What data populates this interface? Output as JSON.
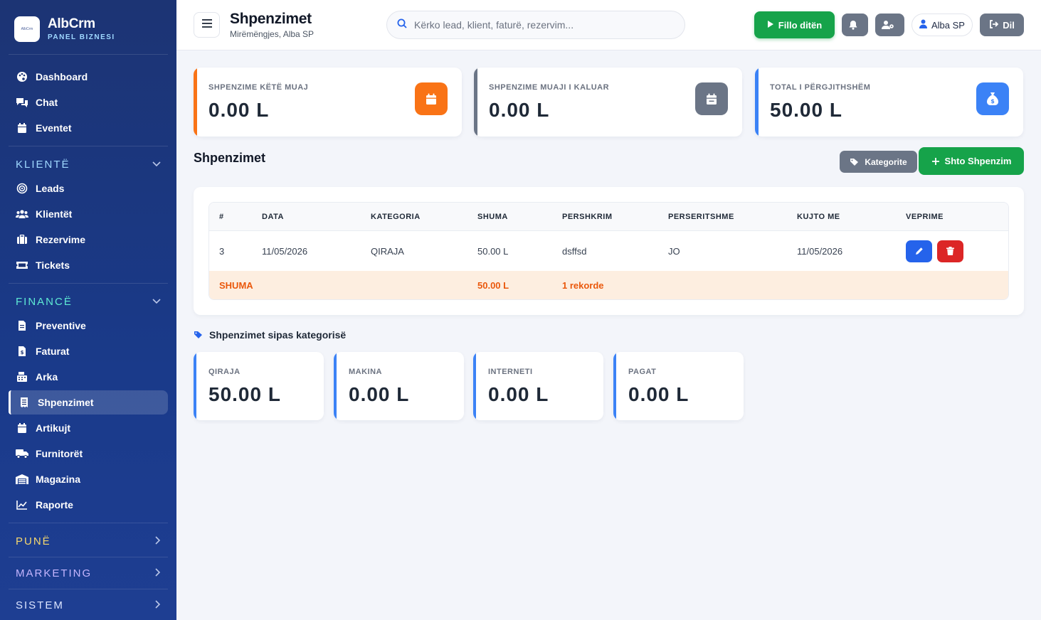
{
  "brand": {
    "logo_text": "AlbCrm",
    "name": "AlbCrm",
    "subtitle": "PANEL BIZNESI"
  },
  "sidebar": {
    "top_items": [
      {
        "label": "Dashboard",
        "icon": "palette-icon"
      },
      {
        "label": "Chat",
        "icon": "chat-icon"
      },
      {
        "label": "Eventet",
        "icon": "calendar-icon"
      }
    ],
    "klientet": {
      "title": "KLIENTË",
      "items": [
        {
          "label": "Leads",
          "icon": "target-icon"
        },
        {
          "label": "Klientët",
          "icon": "users-icon"
        },
        {
          "label": "Rezervime",
          "icon": "suitcase-icon"
        },
        {
          "label": "Tickets",
          "icon": "ticket-icon"
        }
      ]
    },
    "finance": {
      "title": "FINANCË",
      "items": [
        {
          "label": "Preventive",
          "icon": "file-icon"
        },
        {
          "label": "Faturat",
          "icon": "invoice-icon"
        },
        {
          "label": "Arka",
          "icon": "cash-register-icon"
        },
        {
          "label": "Shpenzimet",
          "icon": "receipt-icon",
          "active": true
        },
        {
          "label": "Artikujt",
          "icon": "box-icon"
        },
        {
          "label": "Furnitorët",
          "icon": "truck-icon"
        },
        {
          "label": "Magazina",
          "icon": "warehouse-icon"
        },
        {
          "label": "Raporte",
          "icon": "chart-line-icon"
        }
      ]
    },
    "collapsed_sections": [
      {
        "title": "PUNË",
        "color": "#f5d76e"
      },
      {
        "title": "MARKETING",
        "color": "#c4b5fd"
      },
      {
        "title": "SISTEM",
        "color": "#dbe4ff"
      }
    ]
  },
  "header": {
    "title": "Shpenzimet",
    "greeting": "Mirëmëngjes, Alba SP",
    "search_placeholder": "Kërko lead, klient, faturë, rezervim...",
    "start_day_label": "Fillo ditën",
    "user_label": "Alba SP",
    "exit_label": "Dil"
  },
  "stats": [
    {
      "label": "SHPENZIME KËTË MUAJ",
      "value": "0.00 L",
      "color": "#f97316",
      "icon": "calendar-icon"
    },
    {
      "label": "SHPENZIME MUAJI I KALUAR",
      "value": "0.00 L",
      "color": "#6b7586",
      "icon": "calendar-minus-icon"
    },
    {
      "label": "TOTAL I PËRGJITHSHËM",
      "value": "50.00 L",
      "color": "#3b82f6",
      "icon": "money-bag-icon"
    }
  ],
  "section": {
    "title": "Shpenzimet",
    "categories_label": "Kategorite",
    "add_label": "Shto Shpenzim"
  },
  "table": {
    "headers": [
      "#",
      "DATA",
      "KATEGORIA",
      "SHUMA",
      "PERSHKRIM",
      "PERSERITSHME",
      "KUJTO ME",
      "VEPRIME"
    ],
    "rows": [
      {
        "id": "3",
        "date": "11/05/2026",
        "category": "QIRAJA",
        "amount": "50.00 L",
        "description": "dsffsd",
        "recurring": "JO",
        "remind": "11/05/2026"
      }
    ],
    "summary": {
      "label": "SHUMA",
      "amount": "50.00 L",
      "records": "1 rekorde"
    }
  },
  "by_category": {
    "title": "Shpenzimet sipas kategorisë",
    "items": [
      {
        "label": "QIRAJA",
        "value": "50.00 L"
      },
      {
        "label": "MAKINA",
        "value": "0.00 L"
      },
      {
        "label": "INTERNETI",
        "value": "0.00 L"
      },
      {
        "label": "PAGAT",
        "value": "0.00 L"
      }
    ]
  }
}
